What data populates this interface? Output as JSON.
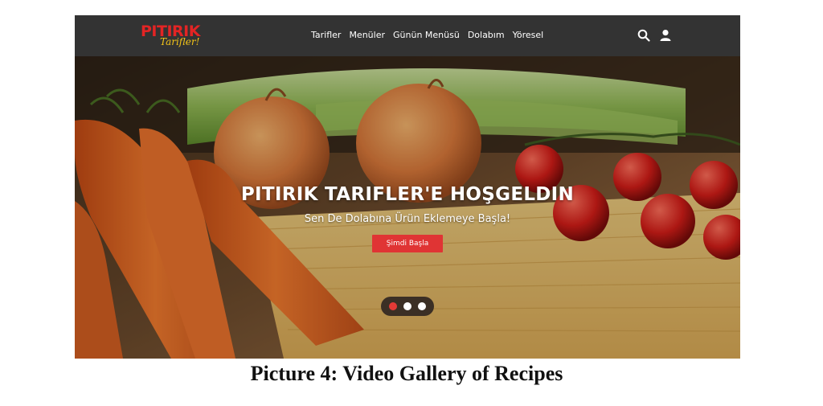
{
  "brand": {
    "name": "PITIRIK",
    "tagline": "Tarifler!",
    "primary_color": "#e32424",
    "accent_color": "#f2c318"
  },
  "navbar": {
    "links": [
      "Tarifler",
      "Menüler",
      "Günün Menüsü",
      "Dolabım",
      "Yöresel"
    ],
    "icons": [
      "search-icon",
      "user-icon"
    ],
    "background": "#333333"
  },
  "hero": {
    "title": "PITIRIK TARIFLER'E HOŞGELDIN",
    "subtitle": "Sen De Dolabına Ürün Eklemeye Başla!",
    "cta_label": "Şimdi Başla",
    "cta_color": "#e03434",
    "slides_total": 3,
    "active_slide": 1
  },
  "caption": "Picture 4: Video Gallery of Recipes"
}
